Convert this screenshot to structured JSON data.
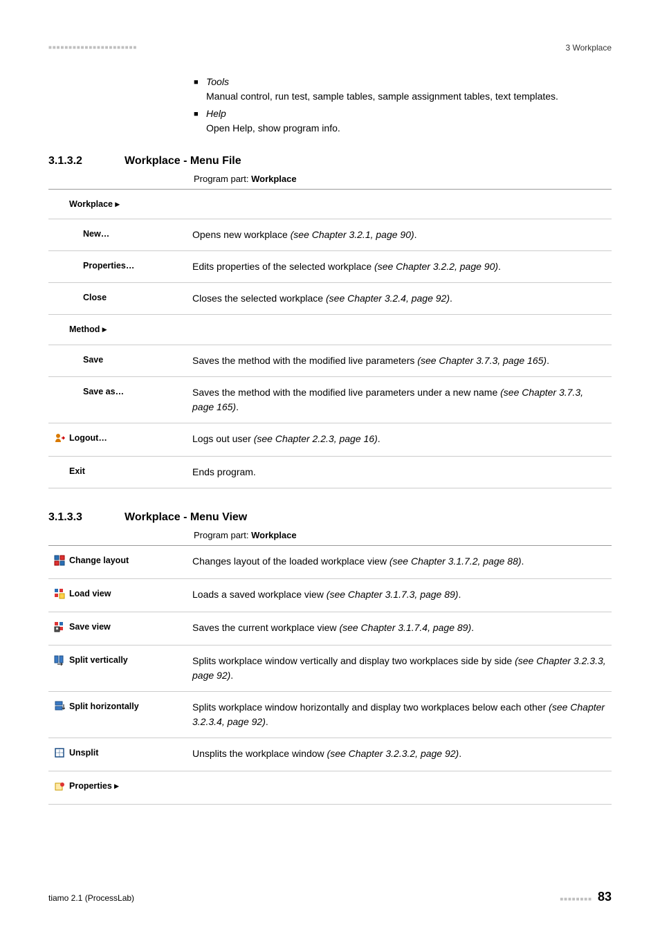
{
  "header": {
    "dashes": "■■■■■■■■■■■■■■■■■■■■■■",
    "right": "3 Workplace"
  },
  "intro": {
    "items": [
      {
        "title": "Tools",
        "text": "Manual control, run test, sample tables, sample assignment tables, text templates."
      },
      {
        "title": "Help",
        "text": "Open Help, show program info."
      }
    ]
  },
  "section_file": {
    "num": "3.1.3.2",
    "title": "Workplace - Menu File",
    "program_part_label": "Program part: ",
    "program_part_value": "Workplace",
    "rows": [
      {
        "label": "Workplace ▸",
        "indent": 1,
        "desc": ""
      },
      {
        "label": "New…",
        "indent": 2,
        "desc": "Opens new workplace ",
        "ref": "(see Chapter 3.2.1, page 90)",
        "tail": "."
      },
      {
        "label": "Properties…",
        "indent": 2,
        "desc": "Edits properties of the selected workplace ",
        "ref": "(see Chapter 3.2.2, page 90)",
        "tail": "."
      },
      {
        "label": "Close",
        "indent": 2,
        "desc": "Closes the selected workplace ",
        "ref": "(see Chapter 3.2.4, page 92)",
        "tail": "."
      },
      {
        "label": "Method ▸",
        "indent": 1,
        "desc": ""
      },
      {
        "label": "Save",
        "indent": 2,
        "desc": "Saves the method with the modified live parameters ",
        "ref": "(see Chapter 3.7.3, page 165)",
        "tail": "."
      },
      {
        "label": "Save as…",
        "indent": 2,
        "desc": "Saves the method with the modified live parameters under a new name ",
        "ref": "(see Chapter 3.7.3, page 165)",
        "tail": "."
      },
      {
        "label": "Logout…",
        "indent": 0,
        "icon": "logout",
        "desc": "Logs out user ",
        "ref": "(see Chapter 2.2.3, page 16)",
        "tail": "."
      },
      {
        "label": "Exit",
        "indent": 1,
        "desc": "Ends program."
      }
    ]
  },
  "section_view": {
    "num": "3.1.3.3",
    "title": "Workplace - Menu View",
    "program_part_label": "Program part: ",
    "program_part_value": "Workplace",
    "rows": [
      {
        "label": "Change layout",
        "icon": "layout",
        "desc": "Changes layout of the loaded workplace view ",
        "ref": "(see Chapter 3.1.7.2, page 88)",
        "tail": "."
      },
      {
        "label": "Load view",
        "icon": "loadview",
        "desc": "Loads a saved workplace view ",
        "ref": "(see Chapter 3.1.7.3, page 89)",
        "tail": "."
      },
      {
        "label": "Save view",
        "icon": "saveview",
        "desc": "Saves the current workplace view ",
        "ref": "(see Chapter 3.1.7.4, page 89)",
        "tail": "."
      },
      {
        "label": "Split vertically",
        "icon": "splitv",
        "desc": "Splits workplace window vertically and display two workplaces side by side ",
        "ref": "(see Chapter 3.2.3.3, page 92)",
        "tail": "."
      },
      {
        "label": "Split horizontally",
        "icon": "splith",
        "desc": "Splits workplace window horizontally and display two workplaces below each other ",
        "ref": "(see Chapter 3.2.3.4, page 92)",
        "tail": "."
      },
      {
        "label": "Unsplit",
        "icon": "unsplit",
        "desc": "Unsplits the workplace window ",
        "ref": "(see Chapter 3.2.3.2, page 92)",
        "tail": "."
      },
      {
        "label": "Properties ▸",
        "icon": "props",
        "desc": ""
      }
    ]
  },
  "footer": {
    "left": "tiamo 2.1 (ProcessLab)",
    "dashes": "■■■■■■■■",
    "page": "83"
  },
  "icons": {
    "logout": "logout-icon",
    "layout": "change-layout-icon",
    "loadview": "load-view-icon",
    "saveview": "save-view-icon",
    "splitv": "split-vertical-icon",
    "splith": "split-horizontal-icon",
    "unsplit": "unsplit-icon",
    "props": "properties-icon"
  }
}
